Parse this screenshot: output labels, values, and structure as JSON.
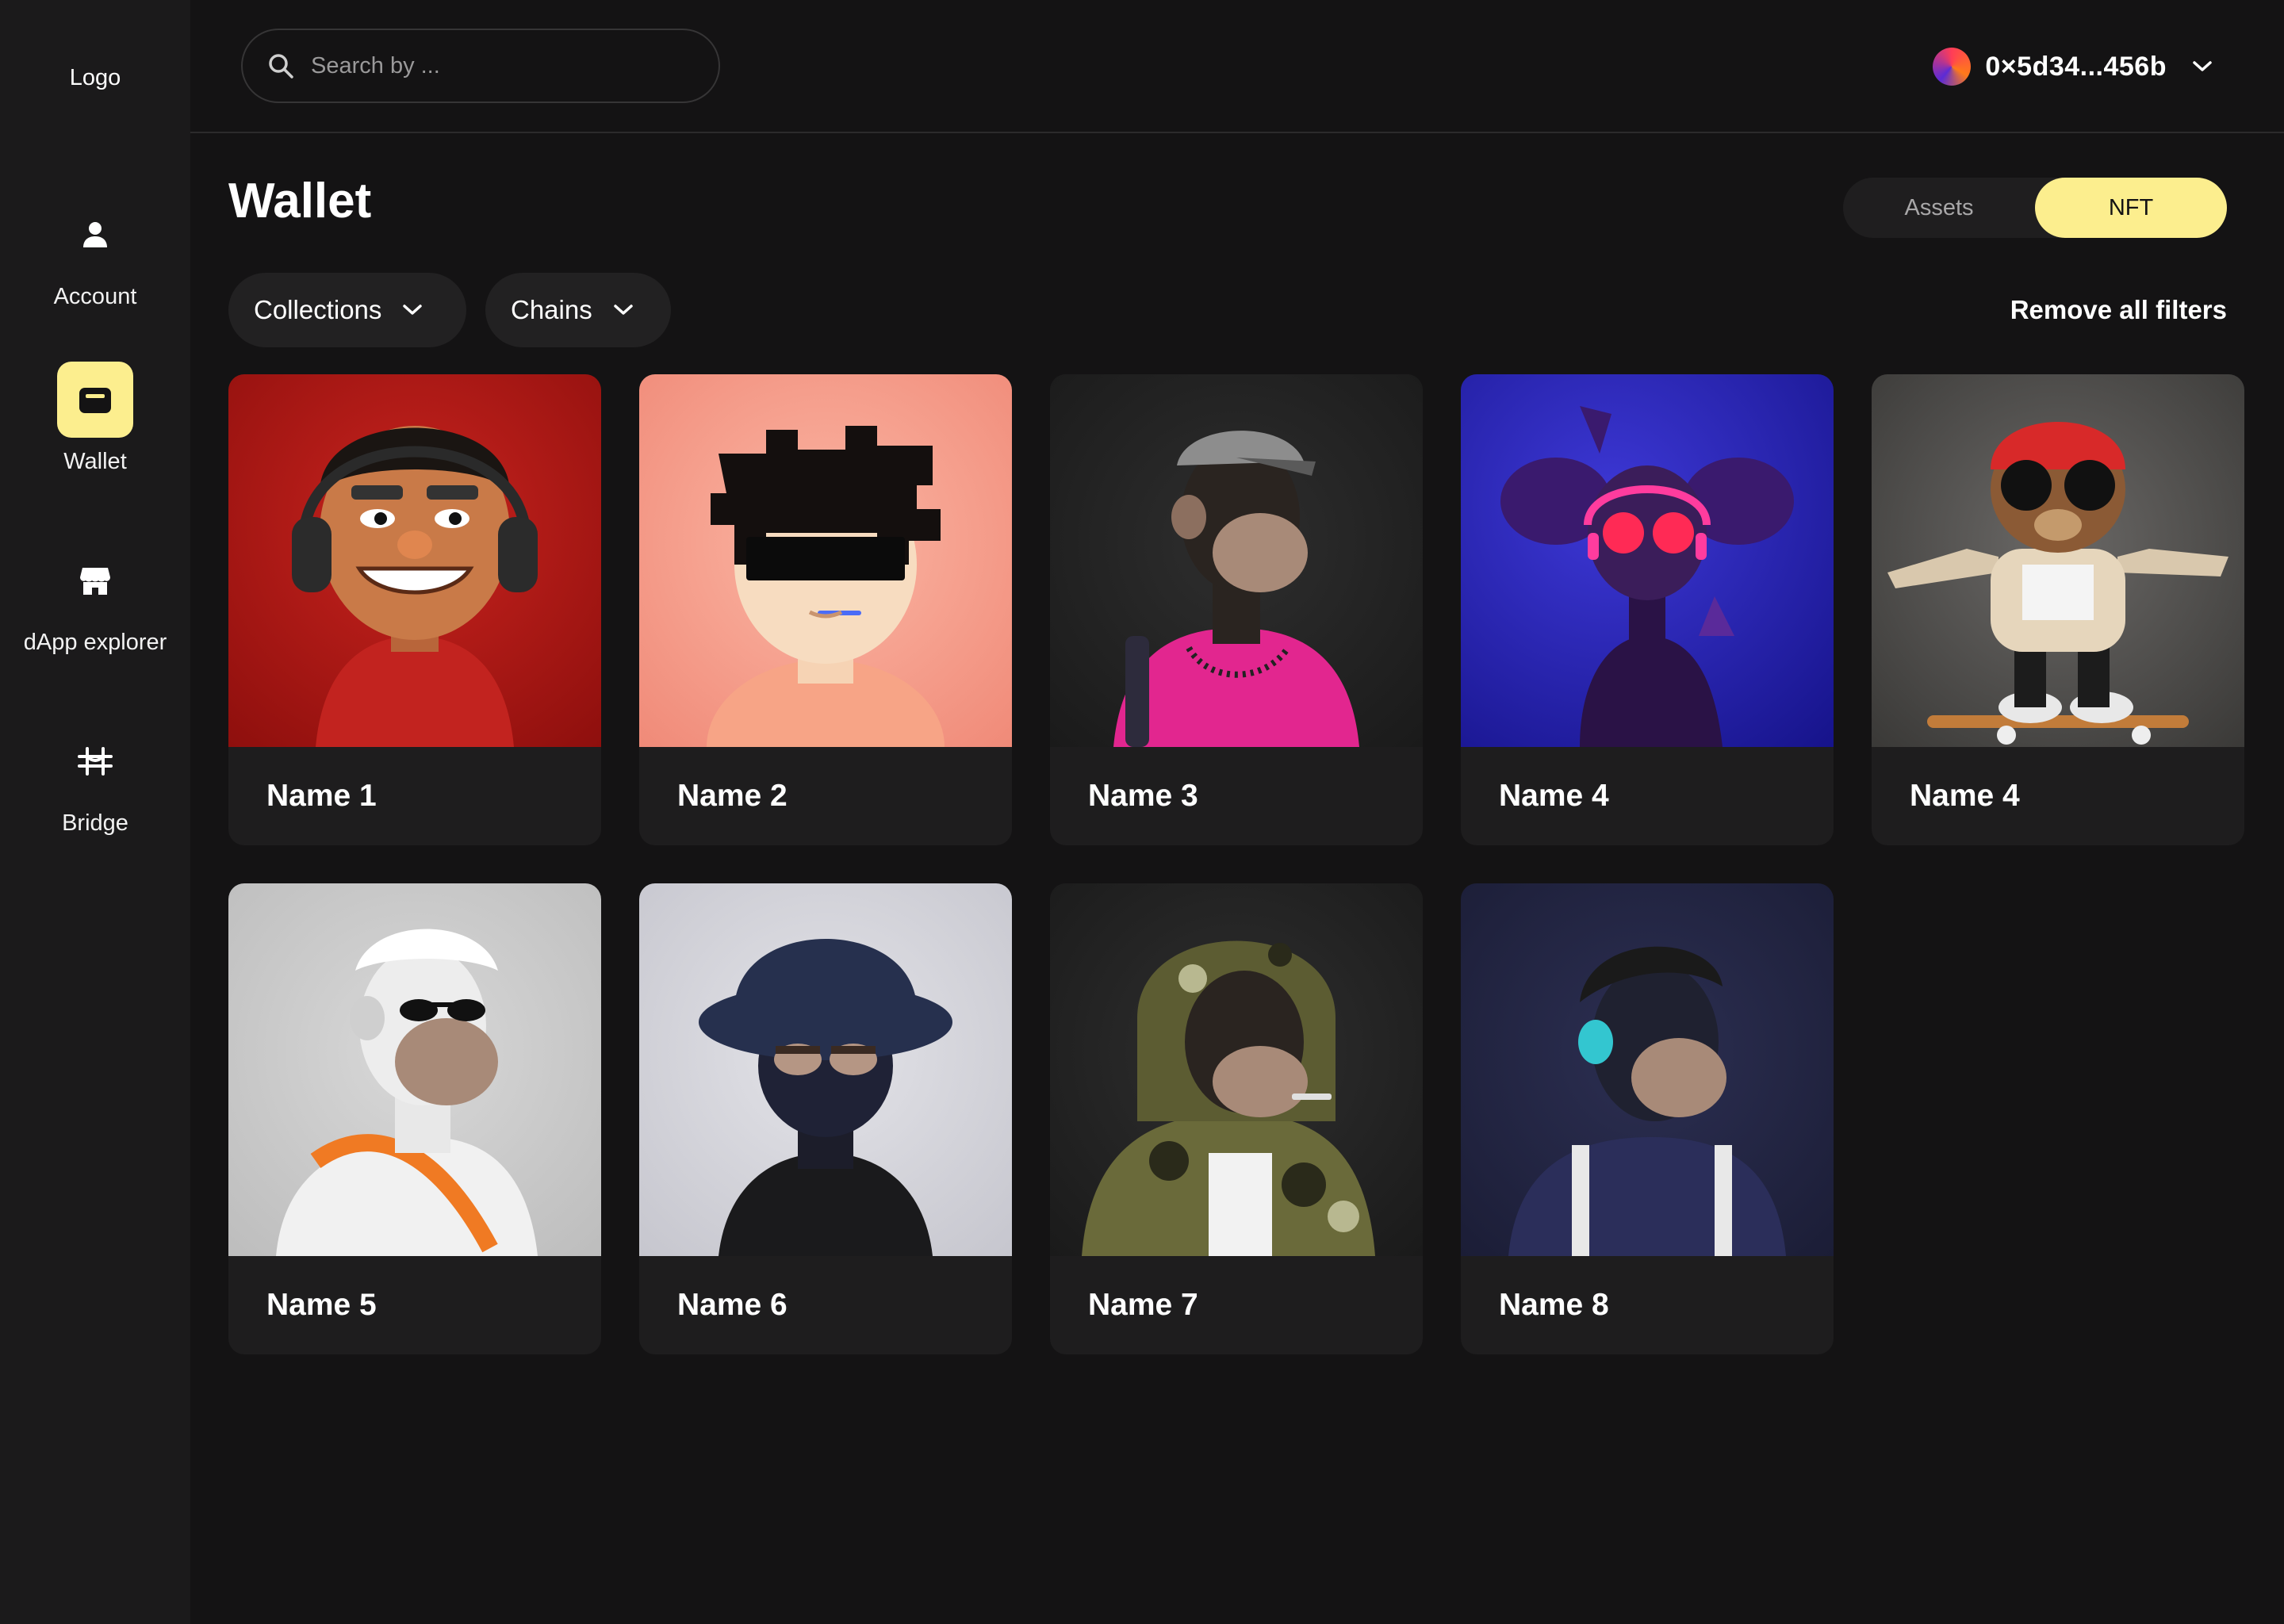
{
  "sidebar": {
    "logo": "Logo",
    "items": [
      {
        "label": "Account",
        "icon": "user-icon",
        "active": false
      },
      {
        "label": "Wallet",
        "icon": "wallet-icon",
        "active": true
      },
      {
        "label": "dApp explorer",
        "icon": "store-icon",
        "active": false
      },
      {
        "label": "Bridge",
        "icon": "bridge-icon",
        "active": false
      }
    ]
  },
  "header": {
    "search_placeholder": "Search by ...",
    "wallet_address": "0×5d34...456b"
  },
  "main": {
    "title": "Wallet",
    "tabs": [
      {
        "label": "Assets",
        "active": false
      },
      {
        "label": "NFT",
        "active": true
      }
    ],
    "filters": [
      {
        "label": "Collections"
      },
      {
        "label": "Chains"
      }
    ],
    "remove_filters_label": "Remove all filters",
    "nfts": [
      {
        "name": "Name 1"
      },
      {
        "name": "Name 2"
      },
      {
        "name": "Name 3"
      },
      {
        "name": "Name 4"
      },
      {
        "name": "Name 4"
      },
      {
        "name": "Name 5"
      },
      {
        "name": "Name 6"
      },
      {
        "name": "Name 7"
      },
      {
        "name": "Name 8"
      }
    ]
  },
  "colors": {
    "accent": "#fcee8e",
    "background": "#141314",
    "sidebar": "#1b1a1b",
    "card": "#1e1d1e"
  }
}
